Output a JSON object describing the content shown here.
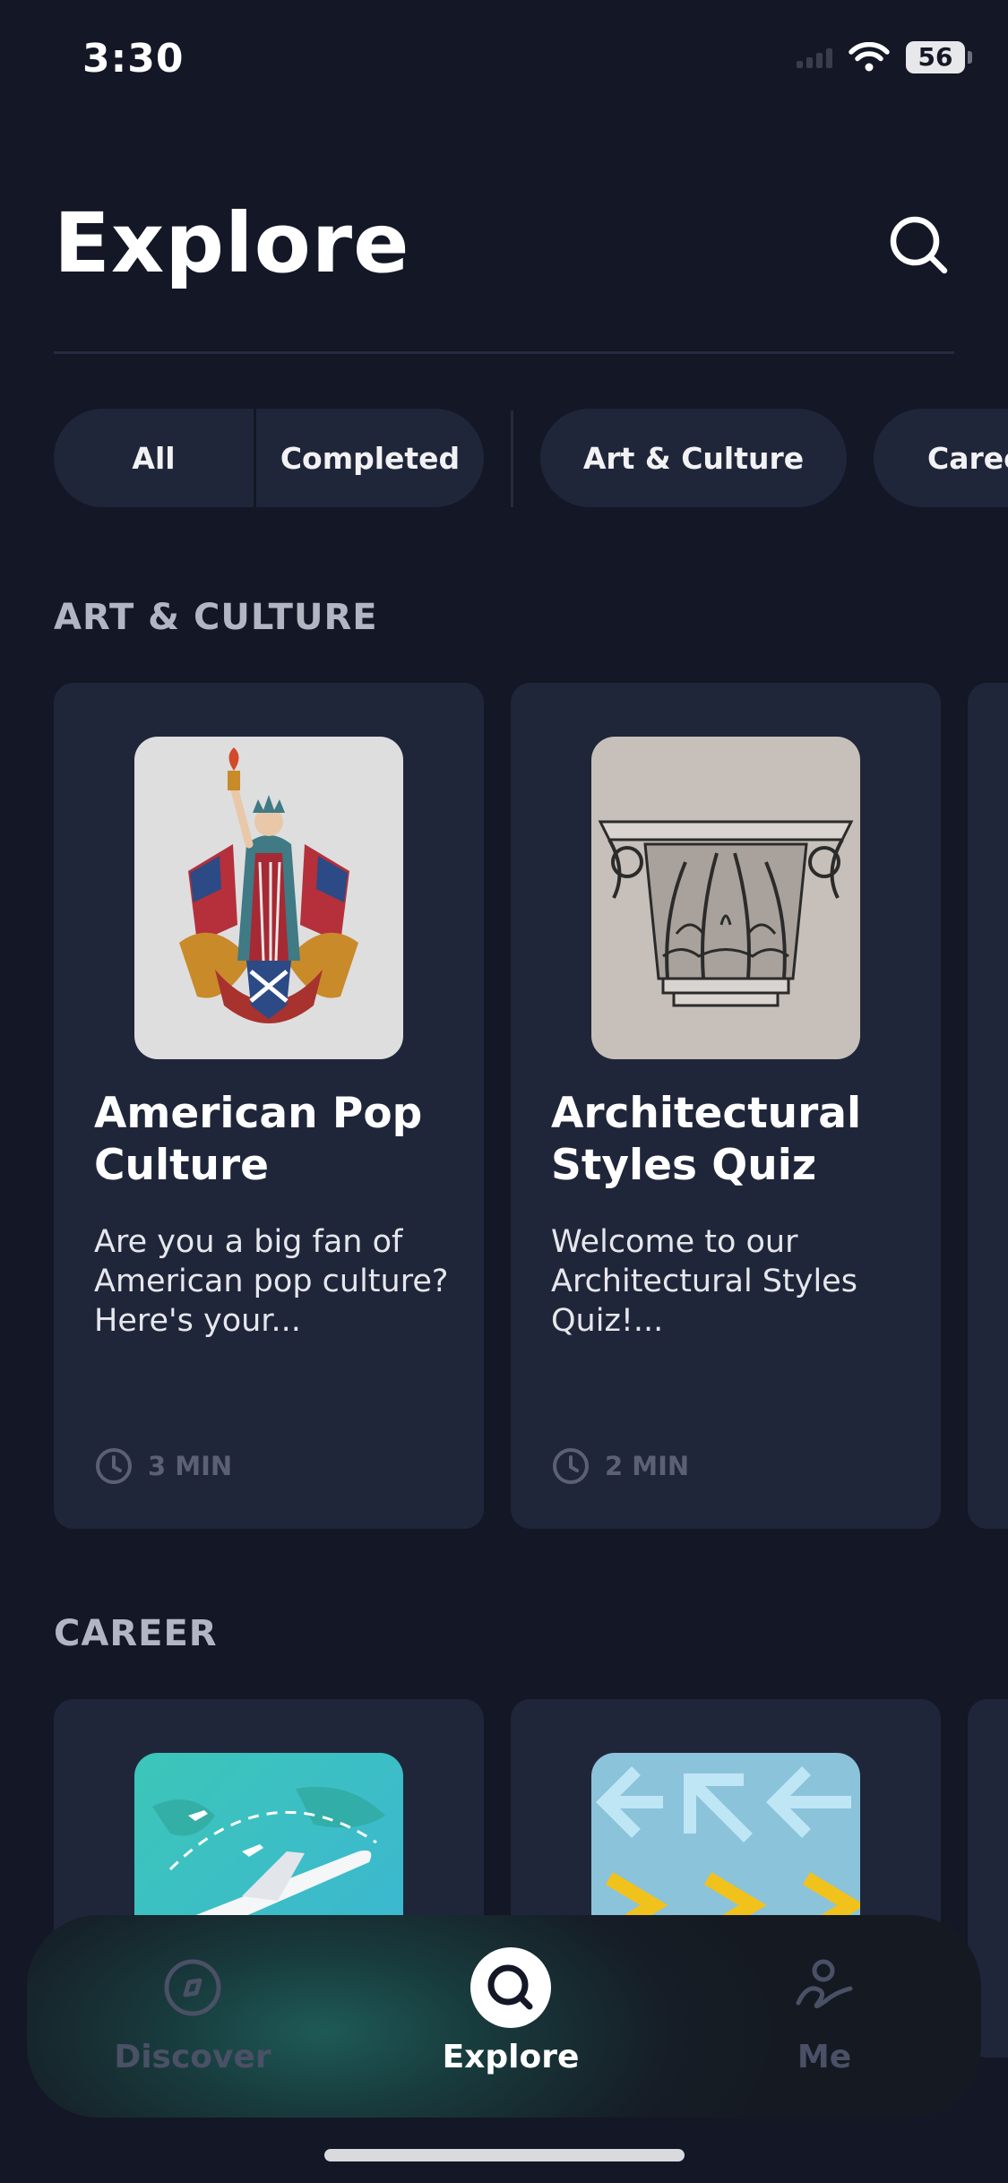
{
  "status_bar": {
    "time": "3:30",
    "battery": "56"
  },
  "header": {
    "title": "Explore",
    "search_icon": "search-icon"
  },
  "filters": {
    "chips": [
      "All",
      "Completed",
      "Art & Culture",
      "Career"
    ]
  },
  "sections": {
    "art_culture": {
      "title": "ART & CULTURE",
      "cards": [
        {
          "title": "American Pop Culture",
          "description": "Are you a big fan of American pop culture? Here's your...",
          "duration": "3 MIN",
          "image_icon": "statue-of-liberty-illustration"
        },
        {
          "title": "Architectural Styles Quiz",
          "description": "Welcome to our Architectural Styles Quiz!...",
          "duration": "2 MIN",
          "image_icon": "corinthian-capital-illustration"
        }
      ]
    },
    "career": {
      "title": "CAREER",
      "cards": [
        {
          "image_icon": "airplane-world-map-illustration"
        },
        {
          "image_icon": "arrows-pattern-illustration"
        }
      ]
    }
  },
  "bottom_nav": {
    "items": [
      {
        "label": "Discover",
        "icon": "compass-icon",
        "active": false
      },
      {
        "label": "Explore",
        "icon": "search-icon",
        "active": true
      },
      {
        "label": "Me",
        "icon": "profile-icon",
        "active": false
      }
    ]
  },
  "colors": {
    "background": "#131726",
    "card": "#20263a",
    "section_title": "#b2b6c2",
    "muted": "#5b6075",
    "nav_glow": "#1e5a56"
  }
}
